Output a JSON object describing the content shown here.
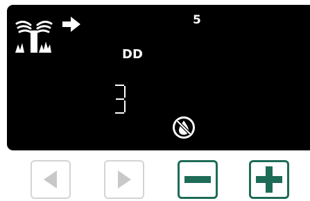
{
  "display": {
    "station_number": "5",
    "mode_label": "DD",
    "value_digit": "3",
    "icons": {
      "sprinkler": "sprinkler-icon",
      "arrow": "arrow-right-icon",
      "no_water": "no-water-icon"
    }
  },
  "buttons": {
    "prev": {
      "icon": "triangle-left-icon",
      "enabled": false
    },
    "next": {
      "icon": "triangle-right-icon",
      "enabled": false
    },
    "minus": {
      "icon": "minus-icon",
      "enabled": true
    },
    "plus": {
      "icon": "plus-icon",
      "enabled": true
    }
  },
  "colors": {
    "lcd_background": "#000000",
    "lcd_foreground": "#ffffff",
    "accent": "#1e6b57",
    "disabled": "#d4d4d4",
    "disabled_icon": "#c8c8c8"
  }
}
